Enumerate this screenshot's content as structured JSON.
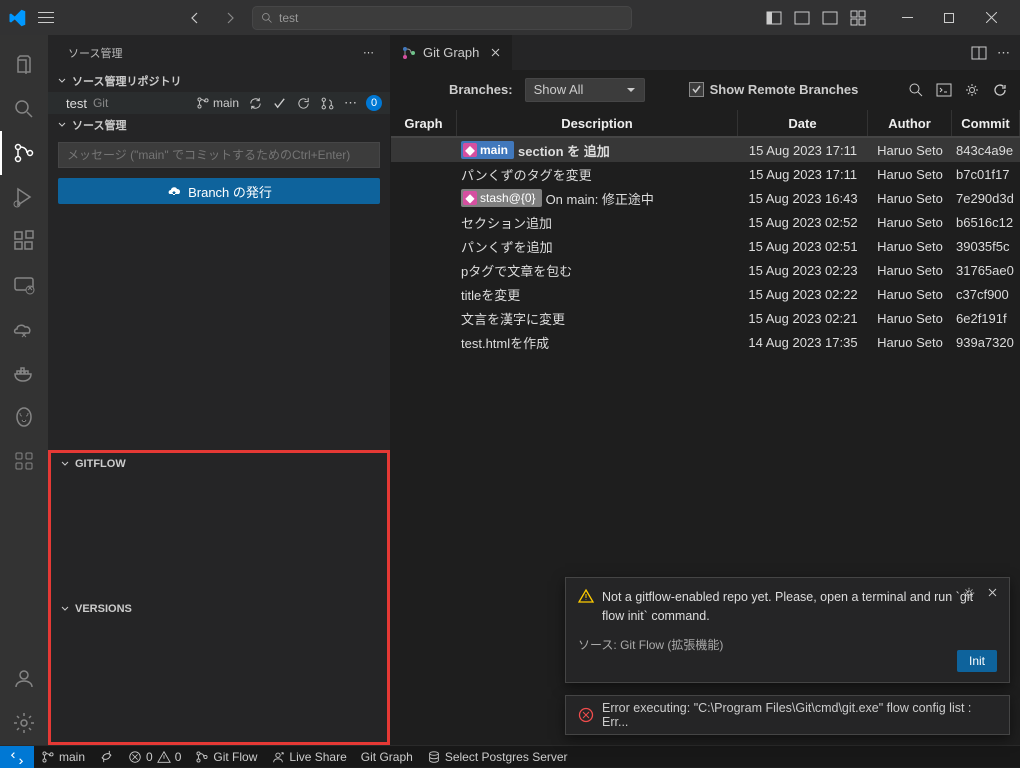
{
  "titlebar": {
    "search": "test"
  },
  "sidebar": {
    "title": "ソース管理",
    "repo_section": "ソース管理リポジトリ",
    "repo_name": "test",
    "repo_type": "Git",
    "branch": "main",
    "badge": "0",
    "scm_section": "ソース管理",
    "msg_placeholder": "メッセージ (\"main\" でコミットするためのCtrl+Enter)",
    "publish": "Branch の発行",
    "gitflow_section": "GITFLOW",
    "versions_section": "VERSIONS"
  },
  "tab": {
    "label": "Git Graph"
  },
  "gitgraph": {
    "branches_label": "Branches:",
    "branches_value": "Show All",
    "show_remote": "Show Remote Branches",
    "head": {
      "graph": "Graph",
      "desc": "Description",
      "date": "Date",
      "author": "Author",
      "commit": "Commit"
    },
    "rows": [
      {
        "tag": "main",
        "desc": "section を 追加",
        "date": "15 Aug 2023 17:11",
        "author": "Haruo Seto",
        "commit": "843c4a9e",
        "head": true
      },
      {
        "desc": "パンくずのタグを変更",
        "date": "15 Aug 2023 17:11",
        "author": "Haruo Seto",
        "commit": "b7c01f17"
      },
      {
        "stash": "stash@{0}",
        "stashmsg": "On main: 修正途中",
        "date": "15 Aug 2023 16:43",
        "author": "Haruo Seto",
        "commit": "7e290d3d"
      },
      {
        "desc": "セクション追加",
        "date": "15 Aug 2023 02:52",
        "author": "Haruo Seto",
        "commit": "b6516c12"
      },
      {
        "desc": "パンくずを追加",
        "date": "15 Aug 2023 02:51",
        "author": "Haruo Seto",
        "commit": "39035f5c"
      },
      {
        "desc": "pタグで文章を包む",
        "date": "15 Aug 2023 02:23",
        "author": "Haruo Seto",
        "commit": "31765ae0"
      },
      {
        "desc": "titleを変更",
        "date": "15 Aug 2023 02:22",
        "author": "Haruo Seto",
        "commit": "c37cf900"
      },
      {
        "desc": "文言を漢字に変更",
        "date": "15 Aug 2023 02:21",
        "author": "Haruo Seto",
        "commit": "6e2f191f"
      },
      {
        "desc": "test.htmlを作成",
        "date": "14 Aug 2023 17:35",
        "author": "Haruo Seto",
        "commit": "939a7320"
      }
    ]
  },
  "notif1": {
    "msg": "Not a gitflow-enabled repo yet. Please, open a terminal and run `git flow init` command.",
    "src": "ソース: Git Flow (拡張機能)",
    "btn": "Init"
  },
  "notif2": {
    "msg": "Error executing: \"C:\\Program Files\\Git\\cmd\\git.exe\" flow config list : Err..."
  },
  "statusbar": {
    "branch": "main",
    "errors": "0",
    "warnings": "0",
    "gitflow": "Git Flow",
    "liveshare": "Live Share",
    "gitgraph": "Git Graph",
    "postgres": "Select Postgres Server"
  }
}
